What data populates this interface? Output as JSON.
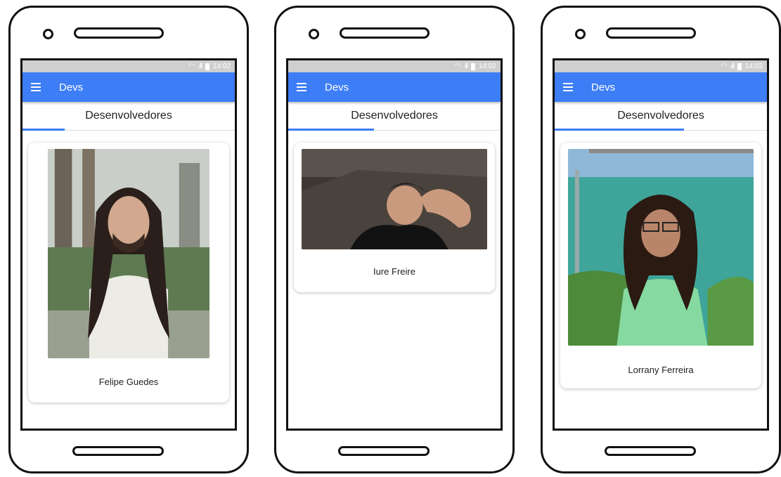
{
  "status": {
    "time": "14:02"
  },
  "app": {
    "title": "Devs",
    "tab_label": "Desenvolvedores"
  },
  "phones": [
    {
      "developer": {
        "name": "Felipe Guedes"
      }
    },
    {
      "developer": {
        "name": "Iure Freire"
      }
    },
    {
      "developer": {
        "name": "Lorrany Ferreira"
      }
    }
  ],
  "colors": {
    "app_bar": "#3d7df5",
    "status_bar": "#cfcfcf",
    "tab_indicator": "#3d7df5"
  },
  "icons": {
    "menu": "hamburger-menu-icon",
    "wifi": "wifi-icon",
    "signal": "signal-icon",
    "battery": "battery-icon"
  }
}
